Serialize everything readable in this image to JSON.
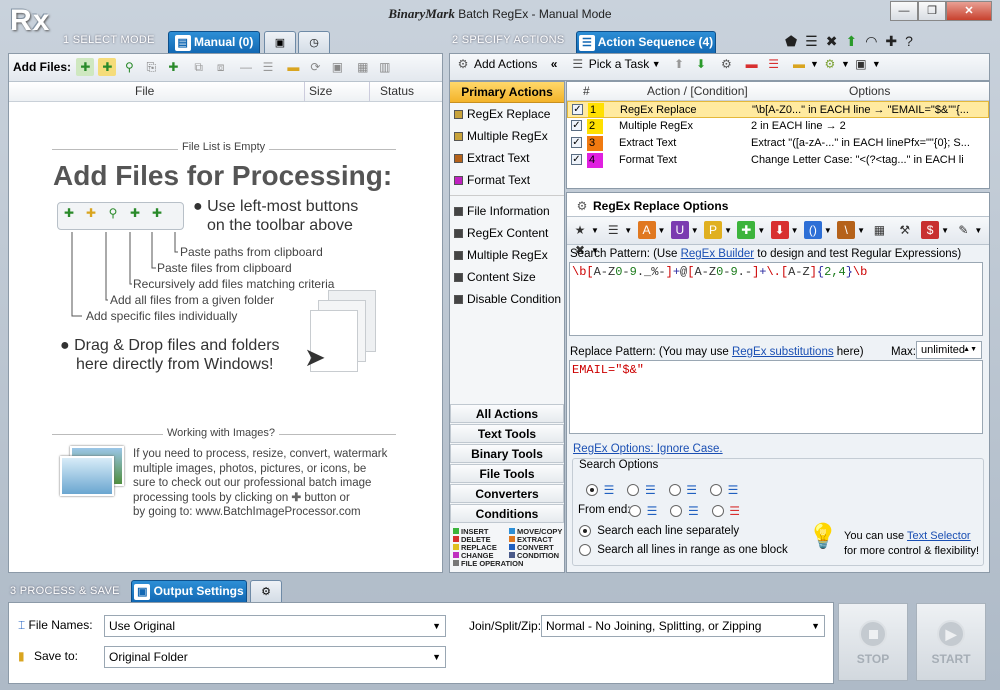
{
  "window": {
    "logo": "Rx",
    "brand": "BinaryMark",
    "title": "Batch RegEx - Manual Mode",
    "min": "—",
    "max": "❐",
    "close": "✕"
  },
  "step1": {
    "label": "1 SELECT MODE",
    "tab_manual": "Manual (0)"
  },
  "step2": {
    "label": "2 SPECIFY ACTIONS",
    "tab_sequence": "Action Sequence (4)"
  },
  "step3": {
    "label": "3 PROCESS & SAVE",
    "tab_output": "Output Settings"
  },
  "files": {
    "toolbar_label": "Add Files:",
    "columns": {
      "file": "File",
      "size": "Size",
      "status": "Status"
    }
  },
  "empty": {
    "caption": "File List is Empty",
    "title": "Add Files for Processing:",
    "bullet1_line1": "Use left-most buttons",
    "bullet1_line2": "on the toolbar above",
    "hints": [
      "Paste paths from clipboard",
      "Paste files from clipboard",
      "Recursively add files matching criteria",
      "Add all files from a given folder",
      "Add specific files individually"
    ],
    "bullet2_line1": "Drag & Drop files and folders",
    "bullet2_line2": "here directly from Windows!",
    "images_caption": "Working with Images?",
    "images_text": [
      "If you need to process, resize, convert, watermark",
      "multiple images, photos, pictures, or icons, be",
      "sure to check out our professional batch image",
      "processing tools by clicking on",
      "button or",
      "by going to: www.BatchImageProcessor.com"
    ]
  },
  "actions_toolbar": {
    "add_actions": "Add Actions",
    "collapse": "«",
    "pick_task": "Pick a Task"
  },
  "primary": {
    "header": "Primary Actions",
    "items": [
      {
        "label": "RegEx Replace",
        "color": "#c8a23a"
      },
      {
        "label": "Multiple RegEx",
        "color": "#c8a23a"
      },
      {
        "label": "Extract Text",
        "color": "#b5621a"
      },
      {
        "label": "Format Text",
        "color": "#c021c0"
      }
    ],
    "items2": [
      {
        "label": "File Information",
        "color": "#444444"
      },
      {
        "label": "RegEx Content",
        "color": "#444444"
      },
      {
        "label": "Multiple RegEx",
        "color": "#444444"
      },
      {
        "label": "Content Size",
        "color": "#444444"
      },
      {
        "label": "Disable Condition",
        "color": "#444444"
      }
    ],
    "categories": [
      "All Actions",
      "Text Tools",
      "Binary Tools",
      "File Tools",
      "Converters",
      "Conditions"
    ],
    "legend": [
      {
        "label": "INSERT",
        "color": "#3cb43c"
      },
      {
        "label": "MOVE/COPY",
        "color": "#2d8fd6"
      },
      {
        "label": "DELETE",
        "color": "#d83030"
      },
      {
        "label": "EXTRACT",
        "color": "#e07820"
      },
      {
        "label": "REPLACE",
        "color": "#e0c020"
      },
      {
        "label": "CONVERT",
        "color": "#2060c0"
      },
      {
        "label": "CHANGE",
        "color": "#c030c0"
      },
      {
        "label": "CONDITION",
        "color": "#4a5a8a"
      },
      {
        "label": "FILE OPERATION",
        "color": "#777777"
      }
    ]
  },
  "sequence": {
    "columns": {
      "num": "#",
      "action": "Action / [Condition]",
      "options": "Options"
    },
    "rows": [
      {
        "num": "1",
        "color": "#ffe000",
        "action": "RegEx Replace",
        "options": "\"\\b[A-Z0...\"  in  EACH  line  →  \"EMAIL=\"$&\"\"{...",
        "checked": "✓"
      },
      {
        "num": "2",
        "color": "#ffe000",
        "action": "Multiple RegEx",
        "options": "2 in EACH line → 2",
        "checked": "✓"
      },
      {
        "num": "3",
        "color": "#f07a10",
        "action": "Extract Text",
        "options": "Extract  \"([a-zA-...\"  in  EACH  linePfx=\"\"{0};  S...",
        "checked": "✓"
      },
      {
        "num": "4",
        "color": "#e020e0",
        "action": "Format Text",
        "options": "Change  Letter  Case:  \"<(?<tag...\"  in  EACH  li",
        "checked": "✓"
      }
    ]
  },
  "options": {
    "tab": "RegEx Replace Options",
    "search_label": "Search Pattern: (Use ",
    "regex_builder": "RegEx Builder",
    "search_label2": " to design and test Regular Expressions)",
    "search_pattern": "\\b[A-Z0-9._%-]+@[A-Z0-9.-]+\\.[A-Z]{2,4}\\b",
    "replace_label": "Replace Pattern: (You may use ",
    "regex_subs": "RegEx substitutions",
    "replace_label2": " here)",
    "max_label": "Max:",
    "max_value": "unlimited",
    "replace_pattern": "EMAIL=\"$&\"",
    "regex_options": "RegEx Options: Ignore Case.",
    "search_options": "Search Options",
    "from_end": "From end:",
    "radio_line": "Search each line separately",
    "radio_all": "Search all lines in range as one block",
    "tip1": "You can use ",
    "text_selector": "Text Selector",
    "tip2": "for more control & flexibility!"
  },
  "output": {
    "file_names_label": "File Names:",
    "file_names_value": "Use Original",
    "save_to_label": "Save to:",
    "save_to_value": "Original Folder",
    "join_label": "Join/Split/Zip:",
    "join_value": "Normal - No Joining, Splitting, or Zipping",
    "stop": "STOP",
    "start": "START"
  }
}
